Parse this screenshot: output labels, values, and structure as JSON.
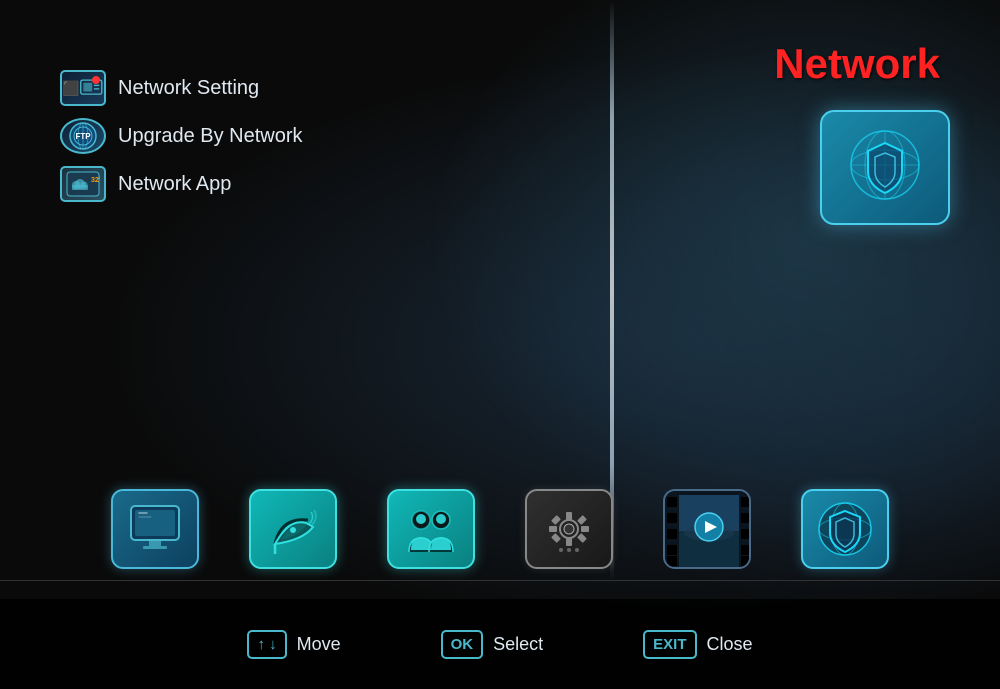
{
  "background": {
    "color": "#000000"
  },
  "header": {
    "title": "Network",
    "title_color": "#ff2222"
  },
  "menu": {
    "items": [
      {
        "label": "Network Setting",
        "icon": "network-setting-icon"
      },
      {
        "label": "Upgrade By Network",
        "icon": "ftp-icon"
      },
      {
        "label": "Network App",
        "icon": "weather-icon"
      }
    ]
  },
  "dock": {
    "icons": [
      {
        "name": "tv",
        "label": "TV"
      },
      {
        "name": "satellite",
        "label": "Satellite"
      },
      {
        "name": "users",
        "label": "Users"
      },
      {
        "name": "settings",
        "label": "Settings"
      },
      {
        "name": "video",
        "label": "Video"
      },
      {
        "name": "network",
        "label": "Network"
      }
    ]
  },
  "controls": {
    "move": {
      "button_label": "↑ ↓",
      "label": "Move"
    },
    "ok": {
      "button_label": "OK",
      "label": "Select"
    },
    "exit": {
      "button_label": "EXIT",
      "label": "Close"
    }
  }
}
